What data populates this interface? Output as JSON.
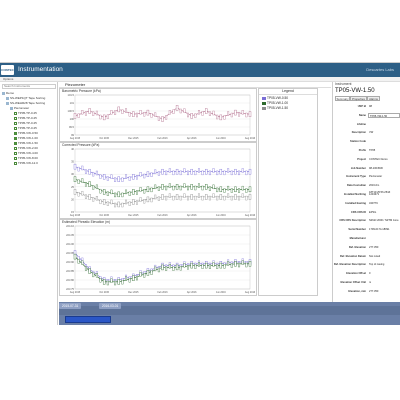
{
  "titlebar": {
    "logo_text": "CONTEC",
    "title": "Instrumentation",
    "user_text": "Descartes Labs"
  },
  "menubar": {
    "item": "Options"
  },
  "sidebar": {
    "search_placeholder": "Search Instruments",
    "tree": [
      {
        "label": "Demo",
        "level": 0,
        "type": "folder"
      },
      {
        "label": "SS-WEP1QT Tape Sorting",
        "level": 1,
        "type": "folder"
      },
      {
        "label": "SS-WEHR28 Tape Sorting",
        "level": 1,
        "type": "folder"
      },
      {
        "label": "Piezometer",
        "level": 2,
        "type": "folder"
      },
      {
        "label": "TP05-TP-0.25",
        "level": 3,
        "checked": false
      },
      {
        "label": "TP05-TP-0.25",
        "level": 3,
        "checked": false
      },
      {
        "label": "TP05-TP-0.25",
        "level": 3,
        "checked": false
      },
      {
        "label": "TP05-TP-0.25",
        "level": 3,
        "checked": false
      },
      {
        "label": "TP05-VW-0.50",
        "level": 3,
        "checked": true
      },
      {
        "label": "TP05-VW-1.00",
        "level": 3,
        "checked": true
      },
      {
        "label": "TP05-VW-1.50",
        "level": 3,
        "checked": true
      },
      {
        "label": "TP05-VW-2.00",
        "level": 3,
        "checked": false
      },
      {
        "label": "TP05-VW-4.00",
        "level": 3,
        "checked": false
      },
      {
        "label": "TP05-VW-8.00",
        "level": 3,
        "checked": false
      },
      {
        "label": "TP05-VW-12.0",
        "level": 3,
        "checked": false
      }
    ]
  },
  "main": {
    "header": "Piezometer",
    "plots": [
      {
        "title": "Barometric Pressure (kPa)",
        "y_ticks": [
          "101.5",
          "101",
          "100.5",
          "100",
          "99.5",
          "99"
        ]
      },
      {
        "title": "Corrected Pressure (kPa)",
        "y_ticks": [
          "40",
          "35",
          "30",
          "25",
          "20",
          "15"
        ]
      },
      {
        "title": "Estimated Phreatic Elevation (m)",
        "y_ticks": [
          "224.10",
          "224.05",
          "224.00",
          "223.95",
          "223.90",
          "223.85",
          "223.80",
          "223.75"
        ]
      }
    ],
    "x_ticks": [
      "Aug 2015",
      "Sep 2015",
      "Oct 2015",
      "Nov 2015",
      "Dec 2015",
      "Jan 2016",
      "Feb 2016",
      "Mar 2016",
      "Apr 2016",
      "May 2016",
      "Jun 2016",
      "Jul 2016",
      "Aug 2016"
    ],
    "legend": {
      "title": "Legend",
      "items": [
        {
          "label": "TP05-VW-0.50",
          "color": "#7b6fd6"
        },
        {
          "label": "TP05-VW-1.00",
          "color": "#2e6b2e"
        },
        {
          "label": "TP05-VW-1.50",
          "color": "#8c8c8c"
        }
      ]
    }
  },
  "chart_data": [
    {
      "type": "line",
      "title": "Barometric Pressure (kPa)",
      "x": [
        "Aug 2015",
        "Sep 2015",
        "Oct 2015",
        "Nov 2015",
        "Dec 2015",
        "Jan 2016",
        "Feb 2016",
        "Mar 2016",
        "Apr 2016",
        "May 2016",
        "Jun 2016",
        "Jul 2016",
        "Aug 2016"
      ],
      "series": [
        {
          "name": "",
          "values": [
            100.2,
            100.5,
            100.1,
            100.6,
            100.3,
            100.4,
            100.0,
            100.7,
            100.2,
            100.5,
            100.1,
            100.4,
            100.3
          ]
        }
      ],
      "ylim": [
        99,
        101.5
      ]
    },
    {
      "type": "line",
      "title": "Corrected Pressure (kPa)",
      "x": [
        "Aug 2015",
        "Sep 2015",
        "Oct 2015",
        "Nov 2015",
        "Dec 2015",
        "Jan 2016",
        "Feb 2016",
        "Mar 2016",
        "Apr 2016",
        "May 2016",
        "Jun 2016",
        "Jul 2016",
        "Aug 2016"
      ],
      "series": [
        {
          "name": "TP05-VW-0.50",
          "values": [
            33,
            31,
            29,
            28,
            29,
            30,
            31,
            31,
            31,
            31,
            31,
            31,
            31
          ]
        },
        {
          "name": "TP05-VW-1.00",
          "values": [
            28,
            26,
            23,
            22,
            23,
            24,
            25,
            25,
            25,
            25,
            24,
            24,
            24
          ]
        },
        {
          "name": "TP05-VW-1.50",
          "values": [
            23,
            21,
            19,
            18,
            19,
            20,
            21,
            21,
            21,
            21,
            21,
            21,
            21
          ]
        }
      ],
      "ylim": [
        15,
        40
      ]
    },
    {
      "type": "line",
      "title": "Estimated Phreatic Elevation (m)",
      "x": [
        "Aug 2015",
        "Sep 2015",
        "Oct 2015",
        "Nov 2015",
        "Dec 2015",
        "Jan 2016",
        "Feb 2016",
        "Mar 2016",
        "Apr 2016",
        "May 2016",
        "Jun 2016",
        "Jul 2016",
        "Aug 2016"
      ],
      "series": [
        {
          "name": "TP05-VW-0.50",
          "values": [
            223.95,
            223.86,
            223.8,
            223.8,
            223.82,
            223.85,
            223.88,
            223.88,
            223.89,
            223.89,
            223.89,
            223.9,
            223.9
          ]
        },
        {
          "name": "TP05-VW-1.00",
          "values": [
            223.93,
            223.85,
            223.79,
            223.79,
            223.81,
            223.84,
            223.87,
            223.87,
            223.88,
            223.88,
            223.88,
            223.89,
            223.89
          ]
        }
      ],
      "ylim": [
        223.75,
        224.1
      ]
    }
  ],
  "right_panel": {
    "header": "Instrument",
    "title": "TP05-VW-1.50",
    "tabs": [
      "Summary",
      "Properties",
      "Alarms"
    ],
    "properties": [
      {
        "label": "USP Id",
        "value": "98"
      },
      {
        "label": "Name",
        "value": "TP05-VW-1.50",
        "boxed": true
      },
      {
        "label": "Lifeline",
        "value": ""
      },
      {
        "label": "Description",
        "value": "VW"
      },
      {
        "label": "Station Code",
        "value": ""
      },
      {
        "label": "Prefix",
        "value": "TP05"
      },
      {
        "label": "Project",
        "value": "CONTEC Demo"
      },
      {
        "label": "Job Number",
        "value": "98-1004530"
      },
      {
        "label": "Instrument Type",
        "value": "Piezometer"
      },
      {
        "label": "Data Custodian",
        "value": "2016-04-18T10:25:56.254Z"
      },
      {
        "label": "Installed Northing",
        "value": "1234371"
      },
      {
        "label": "Installed Easting",
        "value": "340779"
      },
      {
        "label": "CRS CRS ID",
        "value": "EPSG"
      },
      {
        "label": "CRS CRS Description",
        "value": "NZGD 2000 / NZTM zone"
      },
      {
        "label": "Serial Number",
        "value": "1709-0174-18091"
      },
      {
        "label": "Manufacturer",
        "value": ""
      },
      {
        "label": "Ref. Elevation",
        "value": "277.350"
      },
      {
        "label": "Ref. Elevation Datum",
        "value": "Not noted"
      },
      {
        "label": "Ref. Elevation Description",
        "value": "Top of casing"
      },
      {
        "label": "Elevation Offset",
        "value": "0"
      },
      {
        "label": "Elevation Offset Unit",
        "value": "m"
      },
      {
        "label": "Elevation, mm",
        "value": "277.350"
      }
    ]
  },
  "timeline": {
    "start_label": "2015-07-31",
    "end_label": "2016-03-01"
  }
}
